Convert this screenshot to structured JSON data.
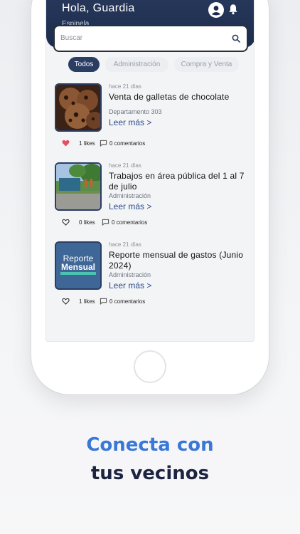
{
  "header": {
    "greeting": "Hola, Guardia",
    "community": "Espinela"
  },
  "search": {
    "placeholder": "Buscar"
  },
  "filters": [
    "Todos",
    "Administración",
    "Compra y Venta"
  ],
  "posts": [
    {
      "time": "hace 21 días",
      "title": "Venta de galletas de chocolate",
      "category": "Departamento 303",
      "read_more": "Leer más >",
      "likes": "1 likes",
      "comments": "0 comentarios",
      "liked": true,
      "image": "chocolate-cookies"
    },
    {
      "time": "hace 21 días",
      "title": "Trabajos en área pública del 1 al 7 de julio",
      "category": "Administración",
      "read_more": "Leer más >",
      "likes": "0 likes",
      "comments": "0 comentarios",
      "liked": false,
      "image": "public-area-works"
    },
    {
      "time": "hace 21 días",
      "title": "Reporte mensual de gastos (Junio 2024)",
      "category": "Administración",
      "read_more": "Leer más >",
      "likes": "1 likes",
      "comments": "0 comentarios",
      "liked": false,
      "image": "reporte-mensual",
      "image_text_1": "Reporte",
      "image_text_2": "Mensual"
    }
  ],
  "tagline": {
    "line1": "Conecta con",
    "line2": "tus vecinos"
  },
  "colors": {
    "header": "#2b3d63",
    "accent_blue": "#3a78d8",
    "heart_red": "#e05263"
  }
}
